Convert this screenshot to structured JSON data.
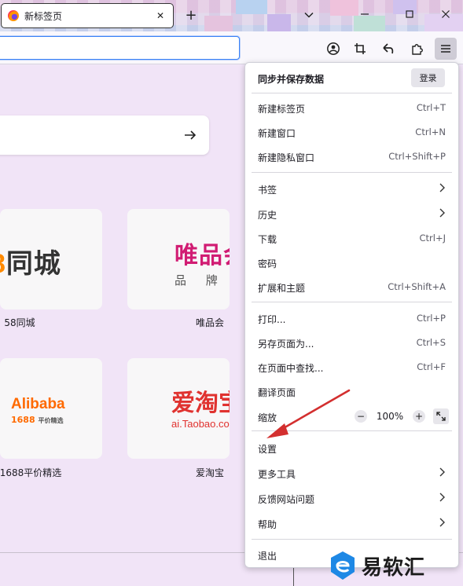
{
  "tab": {
    "title": "新标签页"
  },
  "urlbar": {
    "value": "",
    "placeholder": ""
  },
  "shortcuts": [
    {
      "label": "58同城",
      "logo_main": "同城",
      "logo_digit": "8"
    },
    {
      "label": "唯品会",
      "logo_main": "唯品会",
      "logo_sub": "品 牌 特 卖"
    },
    {
      "label": "1688平价精选",
      "logo_main": "Alibaba",
      "logo_sub": "1688",
      "logo_sub_small": "平价精选"
    },
    {
      "label": "爱淘宝",
      "logo_main": "爱淘宝",
      "logo_sub": "ai.Taobao.com"
    }
  ],
  "menu": {
    "header_title": "同步并保存数据",
    "signin_label": "登录",
    "groups": [
      [
        {
          "label": "新建标签页",
          "shortcut": "Ctrl+T"
        },
        {
          "label": "新建窗口",
          "shortcut": "Ctrl+N"
        },
        {
          "label": "新建隐私窗口",
          "shortcut": "Ctrl+Shift+P"
        }
      ],
      [
        {
          "label": "书签",
          "submenu": true
        },
        {
          "label": "历史",
          "submenu": true
        },
        {
          "label": "下载",
          "shortcut": "Ctrl+J"
        },
        {
          "label": "密码"
        },
        {
          "label": "扩展和主题",
          "shortcut": "Ctrl+Shift+A"
        }
      ],
      [
        {
          "label": "打印...",
          "shortcut": "Ctrl+P"
        },
        {
          "label": "另存页面为...",
          "shortcut": "Ctrl+S"
        },
        {
          "label": "在页面中查找...",
          "shortcut": "Ctrl+F"
        },
        {
          "label": "翻译页面"
        },
        {
          "label": "缩放",
          "zoom": "100%",
          "zoom_out": "−",
          "zoom_in": "+"
        }
      ],
      [
        {
          "label": "设置"
        },
        {
          "label": "更多工具",
          "submenu": true
        },
        {
          "label": "反馈网站问题",
          "submenu": true
        },
        {
          "label": "帮助",
          "submenu": true
        }
      ],
      [
        {
          "label": "退出"
        }
      ]
    ]
  },
  "watermark": {
    "text": "易软汇"
  },
  "colors": {
    "accent_focus": "#3b82f6",
    "annotation_arrow": "#d32f2f",
    "page_bg": "#f1e4f7"
  }
}
